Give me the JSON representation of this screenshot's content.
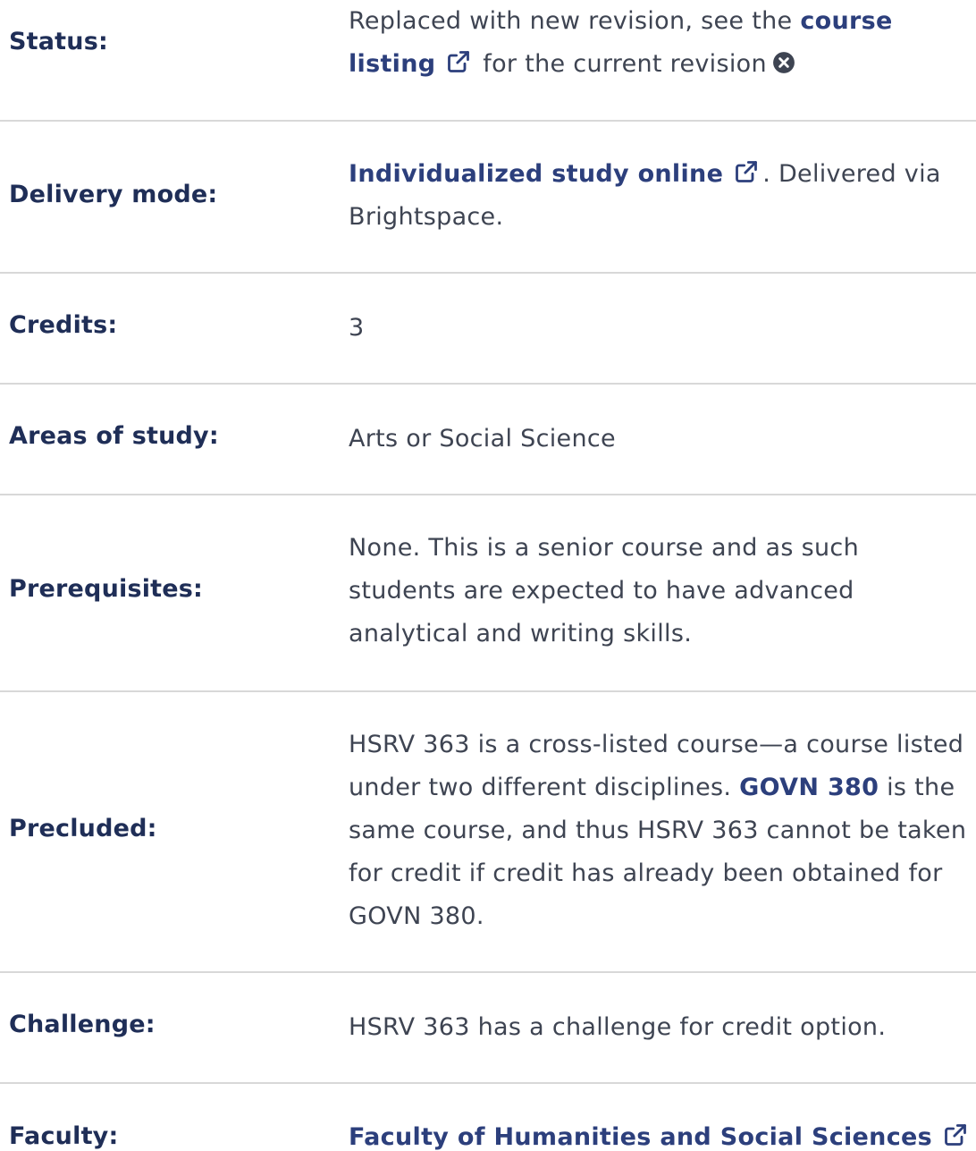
{
  "status": {
    "label": "Status:",
    "text_before": "Replaced with new revision, see the",
    "link": "course listing",
    "text_after": "for the current revision",
    "link_icon": "external-link-icon",
    "close_icon": "times-circle-icon"
  },
  "delivery": {
    "label": "Delivery mode:",
    "link": "Individualized study online",
    "text_after": ". Delivered via Brightspace.",
    "link_icon": "external-link-icon"
  },
  "credits": {
    "label": "Credits:",
    "value": "3"
  },
  "areas": {
    "label": "Areas of study:",
    "value": "Arts or Social Science"
  },
  "prerequisites": {
    "label": "Prerequisites:",
    "value": "None. This is a senior course and as such students are expected to have advanced analytical and writing skills."
  },
  "precluded": {
    "label": "Precluded:",
    "text_before": "HSRV 363 is a cross-listed course—a course listed under two different disciplines.",
    "link": "GOVN 380",
    "text_after": "is the same course, and thus HSRV 363 cannot be taken for credit if credit has already been obtained for GOVN 380."
  },
  "challenge": {
    "label": "Challenge:",
    "value": "HSRV 363 has a challenge for credit option."
  },
  "faculty": {
    "label": "Faculty:",
    "link": "Faculty of Humanities and Social Sciences",
    "link_icon": "external-link-icon"
  },
  "colors": {
    "label": "#1f2e57",
    "link": "#2c3f7c",
    "text": "#3e4452",
    "divider": "#d8d8d8"
  }
}
